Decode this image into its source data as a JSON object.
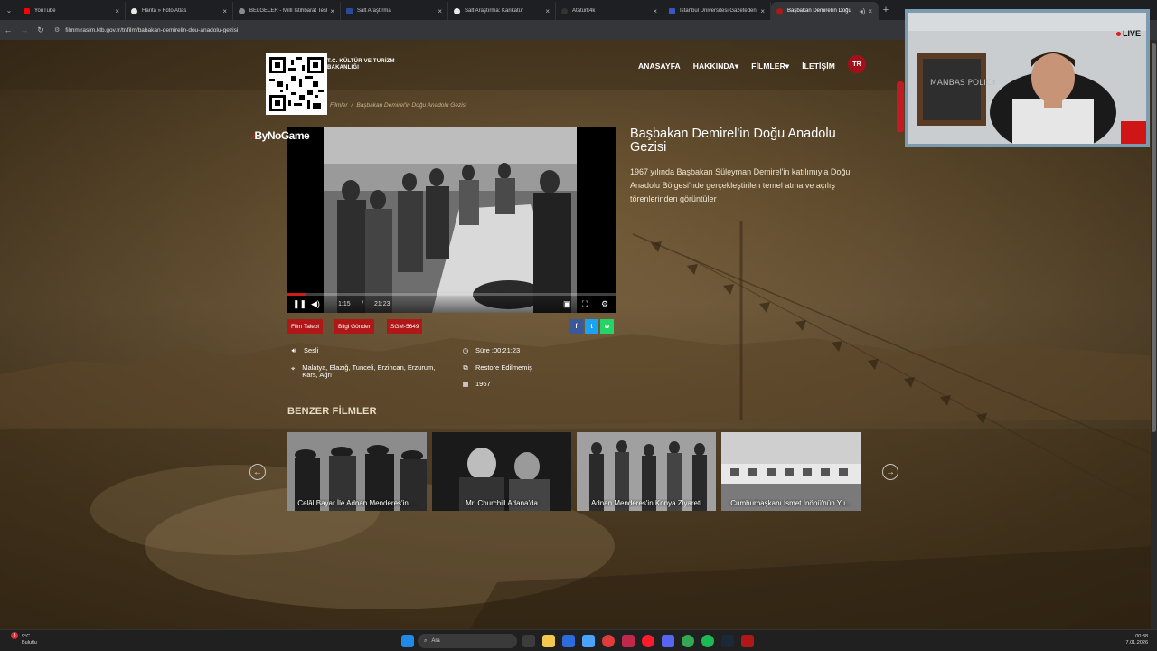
{
  "browser": {
    "tabs": [
      {
        "title": "YouTube",
        "color": "#ff0000"
      },
      {
        "title": "Harita » Foto Atlas",
        "color": "#e8e8e8"
      },
      {
        "title": "BELGELER - Millî İstihbarat Teşk",
        "color": "#8a8a8a"
      },
      {
        "title": "Salt Araştırma",
        "color": "#2a4aa0"
      },
      {
        "title": "Salt Araştırma: Karikatür",
        "color": "#e8e8e8"
      },
      {
        "title": "Ataturk4k",
        "color": "#333333"
      },
      {
        "title": "İstanbul Üniversitesi Gazeteden",
        "color": "#3a55c0"
      },
      {
        "title": "Başbakan Demirel'in Doğu",
        "color": "#b01717"
      }
    ],
    "url": "filmmirasim.ktb.gov.tr/tr/film/babakan-demirelin-dou-anadolu-gezisi"
  },
  "site": {
    "logo_line1": "T.C. KÜLTÜR VE TURİZM",
    "logo_line2": "BAKANLIĞI",
    "nav": [
      "ANASAYFA",
      "HAKKINDA▾",
      "FİLMLER▾",
      "İLETİŞİM"
    ],
    "lang": "TR"
  },
  "breadcrumb": {
    "parent": "Filmler",
    "sep": "/",
    "current": "Başbakan Demirel'in Doğu Anadolu Gezisi"
  },
  "video": {
    "brand": "ByNoGame",
    "current_time": "1:15",
    "time_sep": "/",
    "duration": "21:23",
    "progress": 0.058
  },
  "film": {
    "title": "Başbakan Demirel'in Doğu Anadolu Gezisi",
    "description": "1967 yılında Başbakan Süleyman Demirel'in katılımıyla Doğu Anadolu Bölgesi'nde gerçekleştirilen temel atma ve açılış törenlerinden görüntüler",
    "buttons": [
      "Film Talebi",
      "Bilgi Gönder",
      "SGM-5649"
    ],
    "share": [
      "f",
      "t",
      "w"
    ],
    "sound": "Sesli",
    "locations": "Malatya, Elazığ, Tunceli, Erzincan, Erzurum, Kars, Ağrı",
    "duration_label": "Süre :00:21:23",
    "restore": "Restore Edilmemiş",
    "year": "1967"
  },
  "related": {
    "heading": "BENZER FİLMLER",
    "items": [
      "Celâl Bayar İle Adnan Menderes'in ...",
      "Mr. Churchill Adana'da",
      "Adnan Menderes'in Konya Ziyareti",
      "Cumhurbaşkanı İsmet İnönü'nün Yu..."
    ]
  },
  "overlay": {
    "live": "LIVE",
    "sign_text": "MANBAS POLICY"
  },
  "taskbar": {
    "badge": "3",
    "temp": "9°C",
    "weather": "Bulutlu",
    "search": "Ara",
    "time": "00:38",
    "date": "7.01.2026"
  }
}
